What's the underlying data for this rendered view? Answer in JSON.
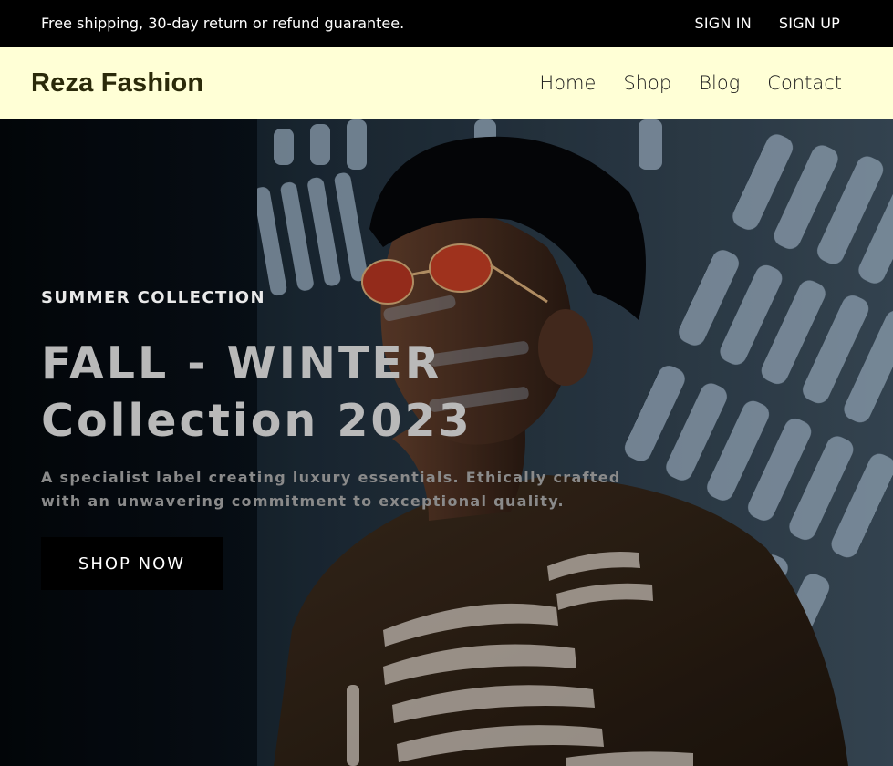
{
  "topbar": {
    "announcement": "Free shipping, 30-day return or refund guarantee.",
    "sign_in": "SIGN IN",
    "sign_up": "SIGN UP"
  },
  "header": {
    "logo": "Reza Fashion",
    "nav": [
      "Home",
      "Shop",
      "Blog",
      "Contact"
    ]
  },
  "hero": {
    "eyebrow": "SUMMER COLLECTION",
    "headline_line1": "FALL - WINTER",
    "headline_line2": "Collection 2023",
    "subtext": "A specialist label creating luxury essentials. Ethically crafted with an unwavering commitment to exceptional quality.",
    "cta": "SHOP NOW",
    "image": "man-with-sunglasses-in-striped-light-photo"
  },
  "colors": {
    "topbar_bg": "#000000",
    "header_bg": "#FFFFD6",
    "button_bg": "#000000"
  }
}
